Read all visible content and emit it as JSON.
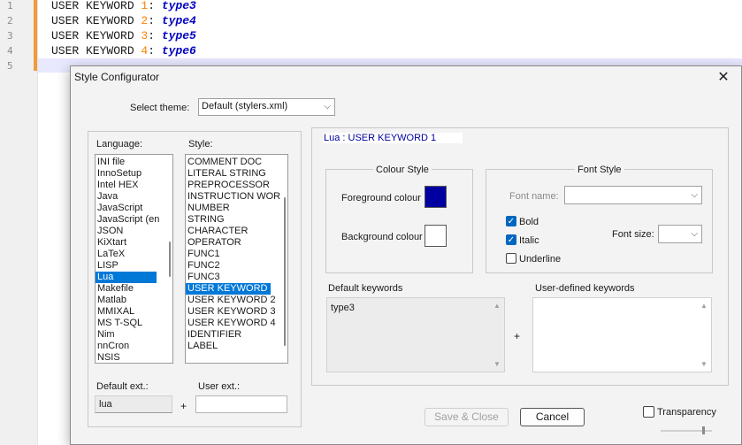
{
  "editor": {
    "line_numbers": [
      "1",
      "2",
      "3",
      "4",
      "5"
    ],
    "lines": [
      {
        "kw": "USER KEYWORD ",
        "num": "1",
        "sep": ": ",
        "type": "type3"
      },
      {
        "kw": "USER KEYWORD ",
        "num": "2",
        "sep": ": ",
        "type": "type4"
      },
      {
        "kw": "USER KEYWORD ",
        "num": "3",
        "sep": ": ",
        "type": "type5"
      },
      {
        "kw": "USER KEYWORD ",
        "num": "4",
        "sep": ": ",
        "type": "type6"
      }
    ]
  },
  "dialog": {
    "title": "Style Configurator",
    "close_glyph": "✕",
    "theme_label": "Select theme:",
    "theme_value": "Default (stylers.xml)",
    "language_label": "Language:",
    "style_label": "Style:",
    "languages": [
      "INI file",
      "InnoSetup",
      "Intel HEX",
      "Java",
      "JavaScript",
      "JavaScript (en",
      "JSON",
      "KiXtart",
      "LaTeX",
      "LISP",
      "Lua",
      "Makefile",
      "Matlab",
      "MMIXAL",
      "MS T-SQL",
      "Nim",
      "nnCron",
      "NSIS"
    ],
    "selected_language": "Lua",
    "styles": [
      "COMMENT DOC",
      "LITERAL STRING",
      "PREPROCESSOR",
      "INSTRUCTION WOR",
      "NUMBER",
      "STRING",
      "CHARACTER",
      "OPERATOR",
      "FUNC1",
      "FUNC2",
      "FUNC3",
      "USER KEYWORD 1",
      "USER KEYWORD 2",
      "USER KEYWORD 3",
      "USER KEYWORD 4",
      "IDENTIFIER",
      "LABEL"
    ],
    "selected_style": "USER KEYWORD 1",
    "default_ext_label": "Default ext.:",
    "default_ext_value": "lua",
    "plus": "+",
    "user_ext_label": "User ext.:",
    "user_ext_value": "",
    "header_title": "Lua : USER KEYWORD 1",
    "colour_style": {
      "title": "Colour Style",
      "foreground_label": "Foreground colour",
      "foreground_color": "#0000a0",
      "background_label": "Background colour",
      "background_color": "#ffffff"
    },
    "font_style": {
      "title": "Font Style",
      "font_name_label": "Font name:",
      "font_name_value": "",
      "font_size_label": "Font size:",
      "font_size_value": "",
      "bold_label": "Bold",
      "bold_checked": true,
      "italic_label": "Italic",
      "italic_checked": true,
      "underline_label": "Underline",
      "underline_checked": false,
      "check_glyph": "✓"
    },
    "default_keywords_label": "Default keywords",
    "default_keywords_value": "type3",
    "user_keywords_label": "User-defined keywords",
    "user_keywords_value": "",
    "save_close_label": "Save & Close",
    "cancel_label": "Cancel",
    "transparency_label": "Transparency",
    "transparency_checked": false,
    "scroll_up_glyph": "▲",
    "scroll_down_glyph": "▼",
    "dropdown_glyph": "⌵"
  }
}
